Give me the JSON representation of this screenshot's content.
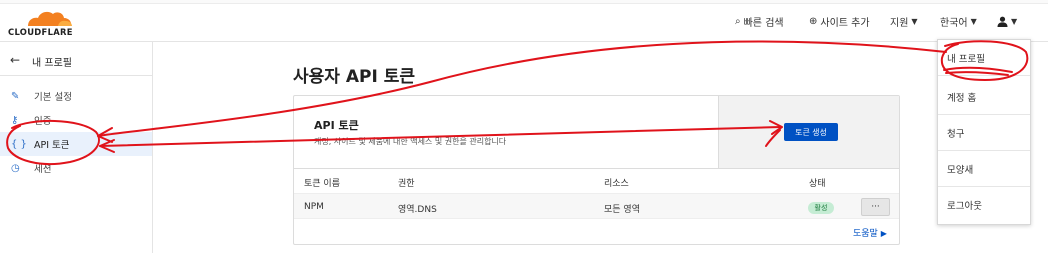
{
  "brand": {
    "logo_text": "CLOUDFLARE",
    "logo_color": "#f38020"
  },
  "topnav": {
    "quick_search": "빠른 검색",
    "add_site": "사이트 추가",
    "support": "지원",
    "language": "한국어"
  },
  "sidebar": {
    "back_title": "내 프로필",
    "items": [
      {
        "label": "기본 설정",
        "icon": "pencil-icon"
      },
      {
        "label": "인증",
        "icon": "key-icon"
      },
      {
        "label": "API 토큰",
        "icon": "braces-icon",
        "active": true
      },
      {
        "label": "세션",
        "icon": "clock-icon"
      }
    ]
  },
  "main": {
    "page_title": "사용자 API 토큰",
    "card": {
      "title": "API 토큰",
      "description": "계정, 사이트 및 제품에 대한 액세스 및 권한을 관리합니다",
      "create_button": "토큰 생성",
      "columns": [
        "토큰 이름",
        "권한",
        "리소스",
        "상태"
      ],
      "rows": [
        {
          "name": "NPM",
          "permission": "영역.DNS",
          "resource": "모든 영역",
          "status": "활성"
        }
      ],
      "more_button": "···",
      "help_link": "도움말"
    }
  },
  "user_menu": {
    "items": [
      "내 프로필",
      "계정 홈",
      "청구",
      "모양새",
      "로그아웃"
    ]
  },
  "colors": {
    "primary": "#0051c3",
    "annotation": "#e0131b",
    "active_bg": "#e9f1fc",
    "badge_bg": "#c5ecd4"
  }
}
